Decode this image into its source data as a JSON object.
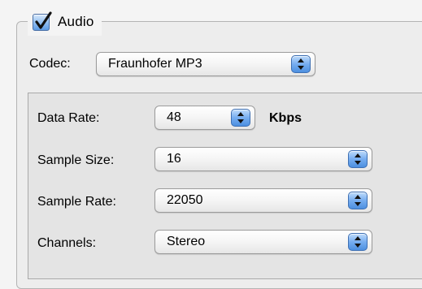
{
  "audio_group": {
    "enabled": true,
    "label": "Audio"
  },
  "codec": {
    "label": "Codec:",
    "value": "Fraunhofer MP3"
  },
  "settings": {
    "data_rate": {
      "label": "Data Rate:",
      "value": "48",
      "unit": "Kbps"
    },
    "sample_size": {
      "label": "Sample Size:",
      "value": "16"
    },
    "sample_rate": {
      "label": "Sample Rate:",
      "value": "22050"
    },
    "channels": {
      "label": "Channels:",
      "value": "Stereo"
    }
  },
  "icons": {
    "checkbox": "checkmark-icon",
    "popup_arrows": "up-down-arrows-icon"
  },
  "colors": {
    "accent_blue": "#5d9be4",
    "window_bg": "#ededed"
  }
}
